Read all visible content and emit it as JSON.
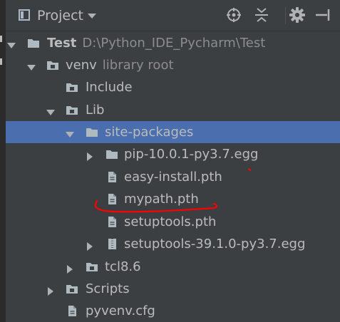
{
  "panel": {
    "title": "Project",
    "title_icon": "project-window-icon",
    "toolbar": [
      "locate-crosshair-icon",
      "collapse-all-icon",
      "gear-icon",
      "hide-panel-icon"
    ]
  },
  "tree": [
    {
      "name": "Test",
      "hint": "D:\\Python_IDE_Pycharm\\Test",
      "type": "folder",
      "expanded": true
    },
    {
      "name": "venv",
      "hint": "library root",
      "type": "library-folder",
      "expanded": true
    },
    {
      "name": "Include",
      "type": "library-folder"
    },
    {
      "name": "Lib",
      "type": "library-folder",
      "expanded": true
    },
    {
      "name": "site-packages",
      "type": "folder",
      "expanded": true,
      "selected": true
    },
    {
      "name": "pip-10.0.1-py3.7.egg",
      "type": "folder",
      "expanded": false
    },
    {
      "name": "easy-install.pth",
      "type": "file"
    },
    {
      "name": "mypath.pth",
      "type": "file",
      "annotated": true
    },
    {
      "name": "setuptools.pth",
      "type": "file"
    },
    {
      "name": "setuptools-39.1.0-py3.7.egg",
      "type": "archive",
      "expanded": false
    },
    {
      "name": "tcl8.6",
      "type": "library-folder",
      "expanded": false
    },
    {
      "name": "Scripts",
      "type": "library-folder",
      "expanded": false
    },
    {
      "name": "pyvenv.cfg",
      "type": "file"
    }
  ],
  "colors": {
    "background": "#3c3f41",
    "selection": "#4b6eaf",
    "text": "#bbbbbb",
    "hint": "#8c8c8c",
    "annotation": "#ff0000"
  }
}
